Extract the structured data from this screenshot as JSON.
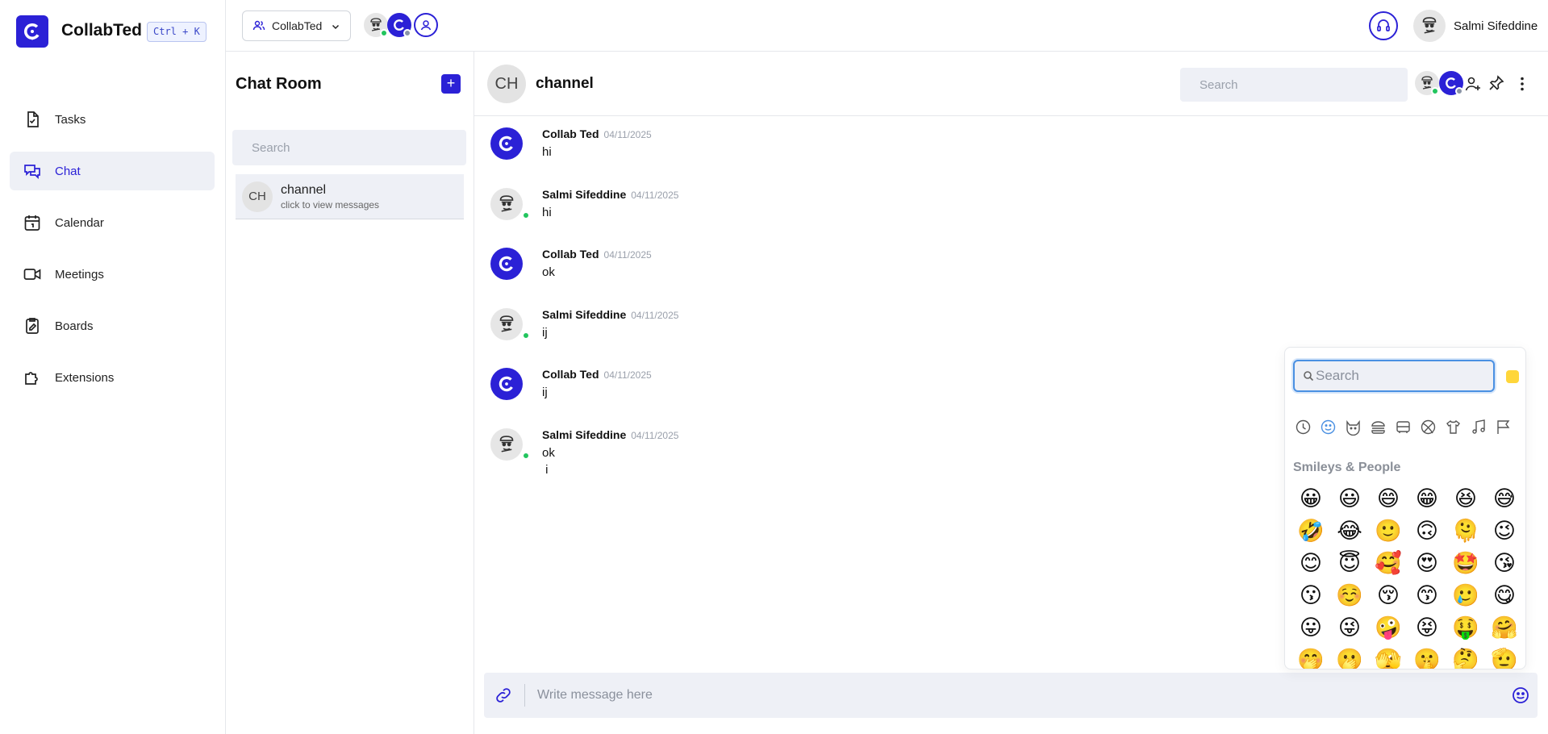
{
  "brand": {
    "name": "CollabTed",
    "shortcut": "Ctrl + K"
  },
  "nav": [
    {
      "label": "Tasks",
      "icon": "tasks-icon",
      "active": false
    },
    {
      "label": "Chat",
      "icon": "chat-icon",
      "active": true
    },
    {
      "label": "Calendar",
      "icon": "calendar-icon",
      "active": false
    },
    {
      "label": "Meetings",
      "icon": "meetings-icon",
      "active": false
    },
    {
      "label": "Boards",
      "icon": "boards-icon",
      "active": false
    },
    {
      "label": "Extensions",
      "icon": "extensions-icon",
      "active": false
    }
  ],
  "topbar": {
    "workspace_label": "CollabTed",
    "user_name": "Salmi Sifeddine"
  },
  "chatroom": {
    "title": "Chat Room",
    "search_placeholder": "Search",
    "rooms": [
      {
        "initials": "CH",
        "name": "channel",
        "subtitle": "click to view messages"
      }
    ]
  },
  "channel": {
    "initials": "CH",
    "name": "channel",
    "search_placeholder": "Search"
  },
  "messages": [
    {
      "author": "Collab Ted",
      "date": "04/11/2025",
      "text": "hi",
      "avatar": "brand"
    },
    {
      "author": "Salmi Sifeddine",
      "date": "04/11/2025",
      "text": "hi",
      "avatar": "chef"
    },
    {
      "author": "Collab Ted",
      "date": "04/11/2025",
      "text": "ok",
      "avatar": "brand"
    },
    {
      "author": "Salmi Sifeddine",
      "date": "04/11/2025",
      "text": "ij",
      "avatar": "chef"
    },
    {
      "author": "Collab Ted",
      "date": "04/11/2025",
      "text": "ij",
      "avatar": "brand"
    },
    {
      "author": "Salmi Sifeddine",
      "date": "04/11/2025",
      "text": "ok\n i",
      "avatar": "chef"
    }
  ],
  "composer": {
    "placeholder": "Write message here"
  },
  "emoji_picker": {
    "search_placeholder": "Search",
    "section_title": "Smileys & People",
    "categories": [
      "recent-icon",
      "smileys-icon",
      "animals-icon",
      "food-icon",
      "travel-icon",
      "activities-icon",
      "objects-icon",
      "symbols-icon",
      "flags-icon"
    ],
    "emojis": [
      "😀",
      "😃",
      "😄",
      "😁",
      "😆",
      "😅",
      "🤣",
      "😂",
      "🙂",
      "🙃",
      "🫠",
      "😉",
      "😊",
      "😇",
      "🥰",
      "😍",
      "🤩",
      "😘",
      "😗",
      "☺️",
      "😚",
      "😙",
      "🥲",
      "😋",
      "😛",
      "😜",
      "🤪",
      "😝",
      "🤑",
      "🤗",
      "🤭",
      "🫢",
      "🫣",
      "🤫",
      "🤔",
      "🫡"
    ]
  }
}
